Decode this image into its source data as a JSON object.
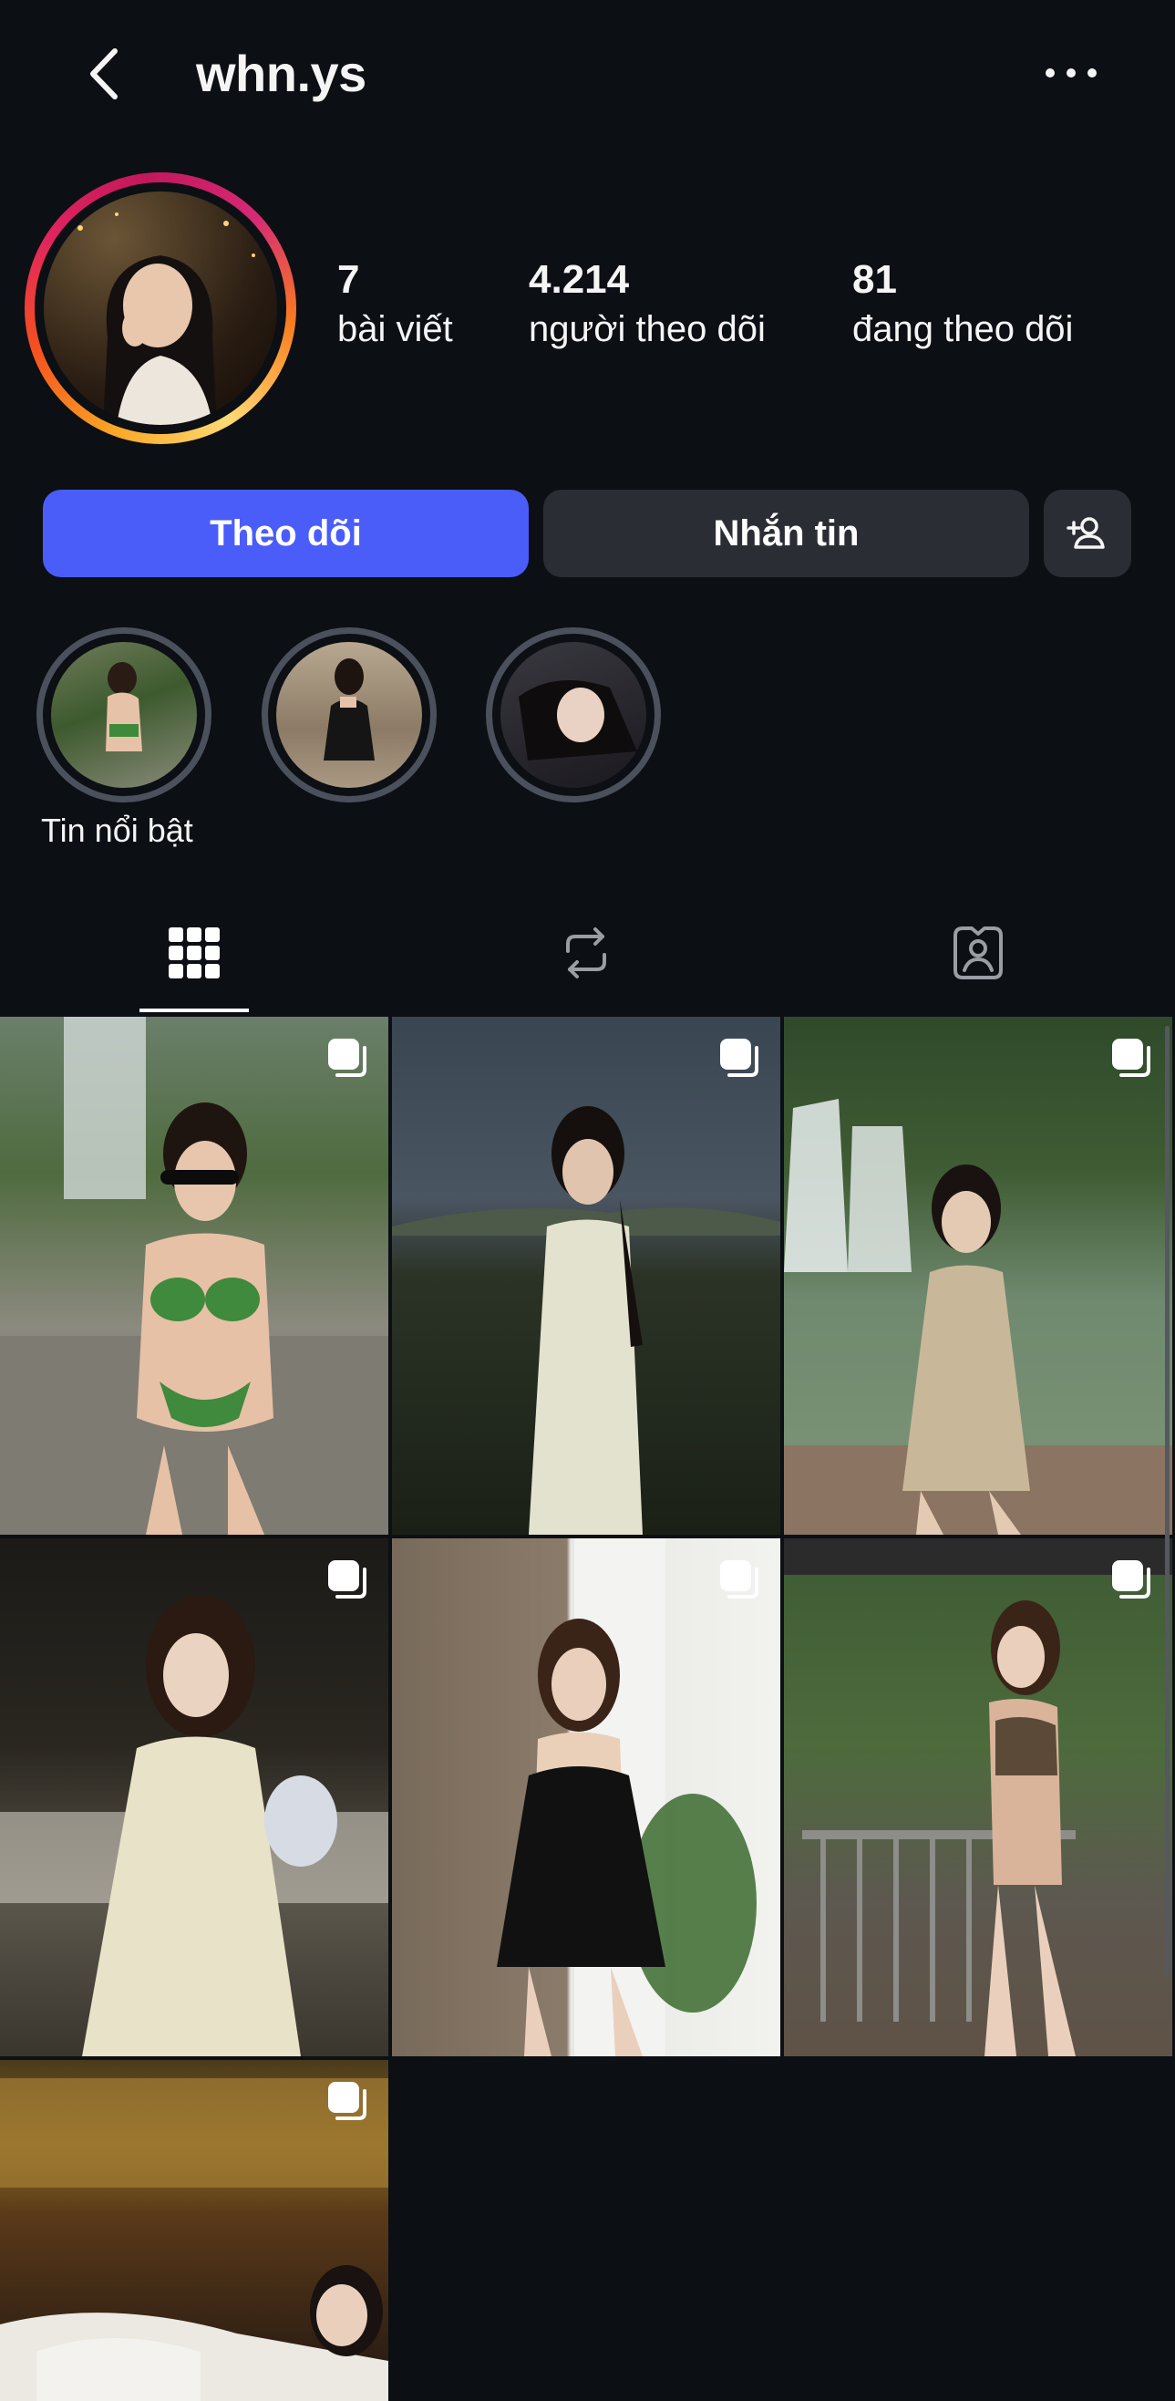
{
  "header": {
    "username": "whn.ys",
    "back_icon": "chevron-left-icon",
    "more_icon": "more-horizontal-icon"
  },
  "profile": {
    "avatar_ring_colors": [
      "#feda75",
      "#fa7e1e",
      "#d62976",
      "#962fbf"
    ],
    "stats": [
      {
        "value": "7",
        "label": "bài viết"
      },
      {
        "value": "4.214",
        "label": "người theo dõi"
      },
      {
        "value": "81",
        "label": "đang theo dõi"
      }
    ]
  },
  "actions": {
    "follow_label": "Theo dõi",
    "message_label": "Nhắn tin",
    "add_user_icon": "add-person-icon",
    "follow_color": "#4a5df9"
  },
  "highlights": {
    "label": "Tin nổi bật",
    "count": 3
  },
  "tabs": [
    {
      "icon": "grid-icon",
      "active": true
    },
    {
      "icon": "repost-icon",
      "active": false
    },
    {
      "icon": "tagged-person-icon",
      "active": false
    }
  ],
  "posts": [
    {
      "scene": "waterfall, green bikini, sunglasses",
      "multi": true
    },
    {
      "scene": "dusk hills, floral dress",
      "multi": true
    },
    {
      "scene": "waterfall pool, beige dress",
      "multi": true
    },
    {
      "scene": "evening table, cream dress",
      "multi": true
    },
    {
      "scene": "wooden wall, black dress",
      "multi": true
    },
    {
      "scene": "balcony railing, lace outfit",
      "multi": true
    },
    {
      "scene": "warm lit room, white top",
      "multi": true
    }
  ]
}
